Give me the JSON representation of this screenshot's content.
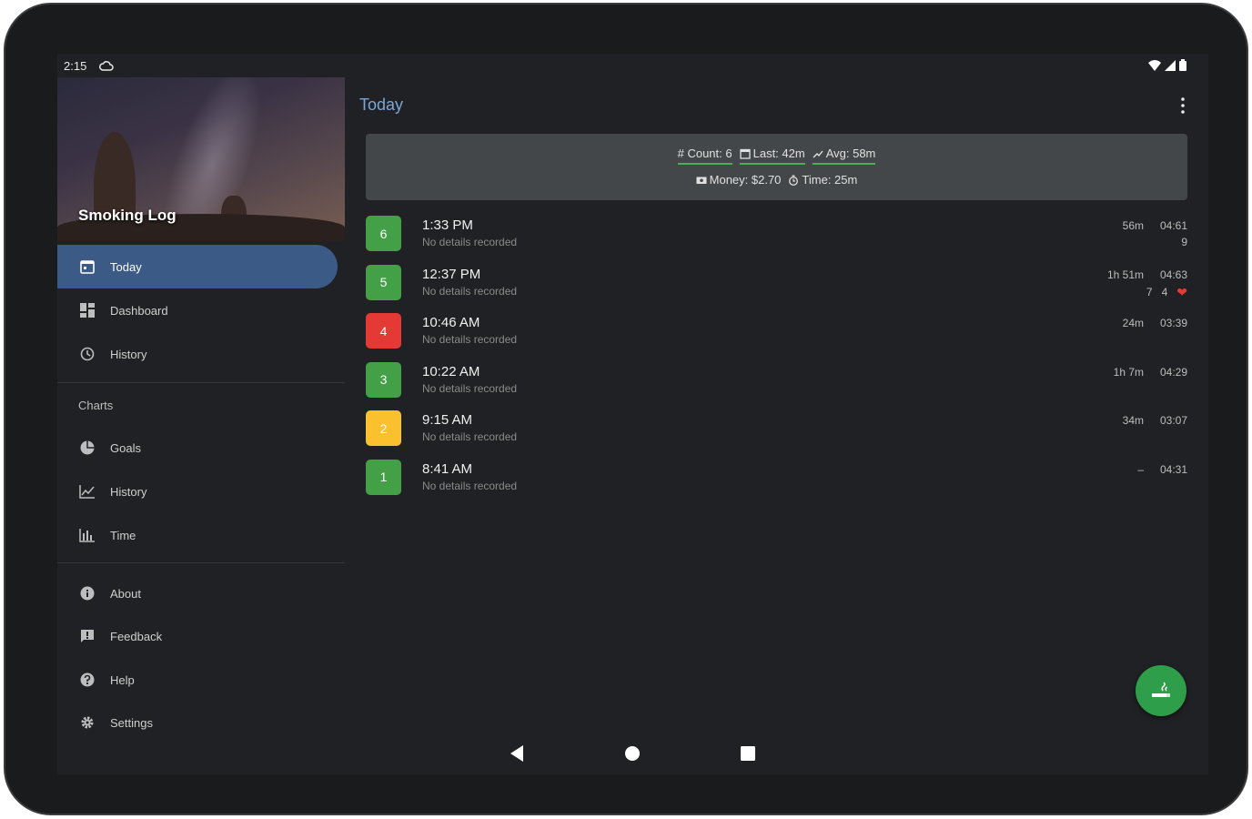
{
  "status": {
    "time": "2:15"
  },
  "drawer": {
    "app_title": "Smoking Log",
    "items_top": [
      {
        "label": "Today",
        "icon": "calendar-icon",
        "active": true
      },
      {
        "label": "Dashboard",
        "icon": "dashboard-icon"
      },
      {
        "label": "History",
        "icon": "history-icon"
      }
    ],
    "charts_label": "Charts",
    "items_charts": [
      {
        "label": "Goals",
        "icon": "pie-icon"
      },
      {
        "label": "History",
        "icon": "line-chart-icon"
      },
      {
        "label": "Time",
        "icon": "bar-chart-icon"
      }
    ],
    "items_bottom": [
      {
        "label": "About",
        "icon": "info-icon"
      },
      {
        "label": "Feedback",
        "icon": "feedback-icon"
      },
      {
        "label": "Help",
        "icon": "help-icon"
      },
      {
        "label": "Settings",
        "icon": "gear-icon"
      }
    ]
  },
  "main": {
    "title": "Today",
    "summary": {
      "count": "# Count: 6",
      "last": "Last: 42m",
      "avg": "Avg: 58m",
      "money": "Money: $2.70",
      "time": "Time: 25m"
    },
    "entries": [
      {
        "num": "6",
        "color": "#43a047",
        "time": "1:33 PM",
        "detail": "No details recorded",
        "gap": "56m",
        "dur": "04:61",
        "extra": [
          "9"
        ]
      },
      {
        "num": "5",
        "color": "#43a047",
        "time": "12:37 PM",
        "detail": "No details recorded",
        "gap": "1h 51m",
        "dur": "04:63",
        "extra": [
          "7",
          "4",
          "❤"
        ]
      },
      {
        "num": "4",
        "color": "#e53935",
        "time": "10:46 AM",
        "detail": "No details recorded",
        "gap": "24m",
        "dur": "03:39",
        "extra": []
      },
      {
        "num": "3",
        "color": "#43a047",
        "time": "10:22 AM",
        "detail": "No details recorded",
        "gap": "1h 7m",
        "dur": "04:29",
        "extra": []
      },
      {
        "num": "2",
        "color": "#fbc02d",
        "time": "9:15 AM",
        "detail": "No details recorded",
        "gap": "34m",
        "dur": "03:07",
        "extra": []
      },
      {
        "num": "1",
        "color": "#43a047",
        "time": "8:41 AM",
        "detail": "No details recorded",
        "gap": "–",
        "dur": "04:31",
        "extra": []
      }
    ]
  },
  "colors": {
    "accent": "#3b5a86",
    "title": "#7aa7d8",
    "fab": "#2e9e4a",
    "underline": "#4caf50"
  }
}
